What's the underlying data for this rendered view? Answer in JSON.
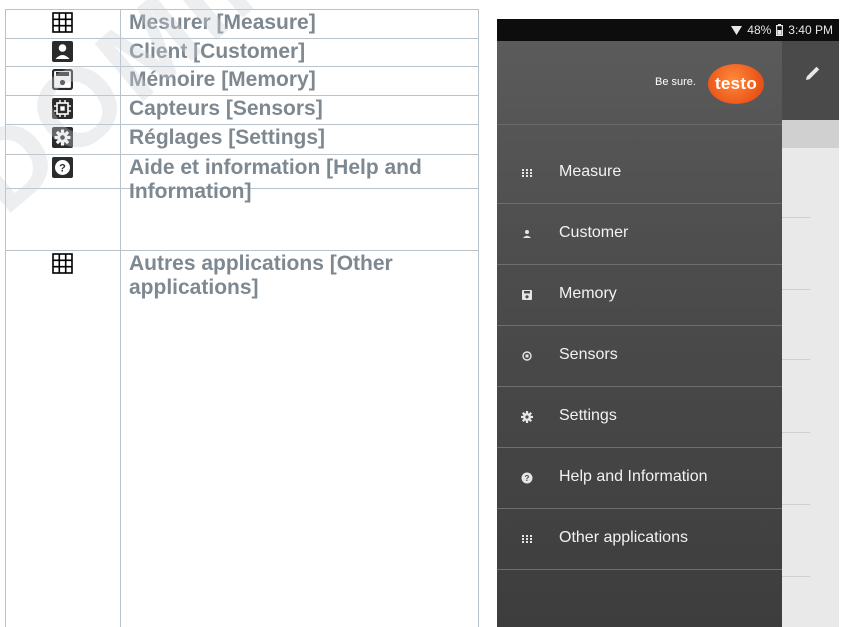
{
  "doc_table": {
    "rows": [
      {
        "icon": "grid-icon",
        "text": "Mesurer [Measure]"
      },
      {
        "icon": "person-icon",
        "text": "Client [Customer]"
      },
      {
        "icon": "save-icon",
        "text": "Mémoire [Memory]"
      },
      {
        "icon": "chip-icon",
        "text": "Capteurs [Sensors]"
      },
      {
        "icon": "gear-icon",
        "text": "Réglages [Settings]"
      },
      {
        "icon": "help-icon",
        "text": "Aide et information [Help and Information]"
      },
      {
        "icon": "grid-icon",
        "text": "Autres applications [Other applications]"
      }
    ]
  },
  "watermark": "DOMINIQUE DUTSCHER",
  "phone": {
    "status": {
      "battery": "48%",
      "time": "3:40 PM"
    },
    "brand": {
      "slogan": "Be sure.",
      "logo": "testo",
      "logo_color": "#ee5b1d"
    },
    "menu": [
      {
        "icon": "grid-icon",
        "label": "Measure"
      },
      {
        "icon": "person-icon",
        "label": "Customer"
      },
      {
        "icon": "save-icon",
        "label": "Memory"
      },
      {
        "icon": "chip-icon",
        "label": "Sensors"
      },
      {
        "icon": "gear-icon",
        "label": "Settings"
      },
      {
        "icon": "help-icon",
        "label": "Help and Information"
      },
      {
        "icon": "grid-icon",
        "label": "Other applications"
      }
    ]
  }
}
